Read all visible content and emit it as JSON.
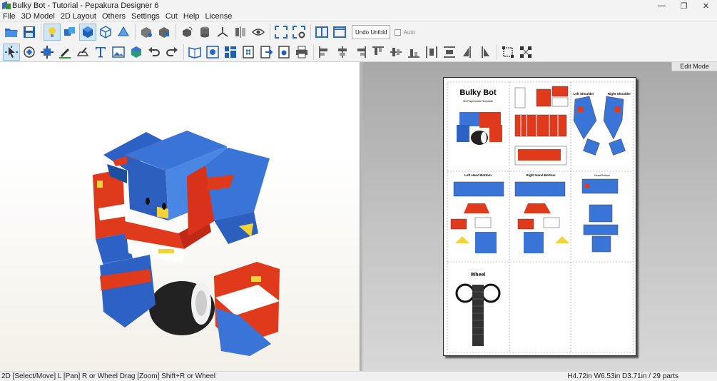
{
  "window": {
    "title": "Bulky Bot - Tutorial - Pepakura Designer 6",
    "minimize": "—",
    "maximize": "❐",
    "close": "✕"
  },
  "menu": [
    "File",
    "3D Model",
    "2D Layout",
    "Others",
    "Settings",
    "Cut",
    "Help",
    "License"
  ],
  "toolbar": {
    "undo_unfold_label": "Undo Unfold",
    "auto_label": "Auto"
  },
  "view2d": {
    "mode_label": "Edit Mode"
  },
  "layout": {
    "title": "Bulky Bot",
    "subtitle": "3D Papercraft Template",
    "part_labels": [
      "Left Shoulder",
      "Right Shoulder",
      "Left Hand Bottom",
      "Right Hand Bottom",
      "Head Bottom",
      "Wheel"
    ]
  },
  "status": {
    "left": "2D [Select/Move] L [Pan] R or Wheel Drag [Zoom] Shift+R or Wheel",
    "right": "H4.72in W6.53in D3.71in / 29 parts"
  },
  "colors": {
    "model_blue": "#3a74d6",
    "model_red": "#e03a1c",
    "model_yellow": "#f3d23a",
    "accent_highlight": "#cfe4f7"
  }
}
